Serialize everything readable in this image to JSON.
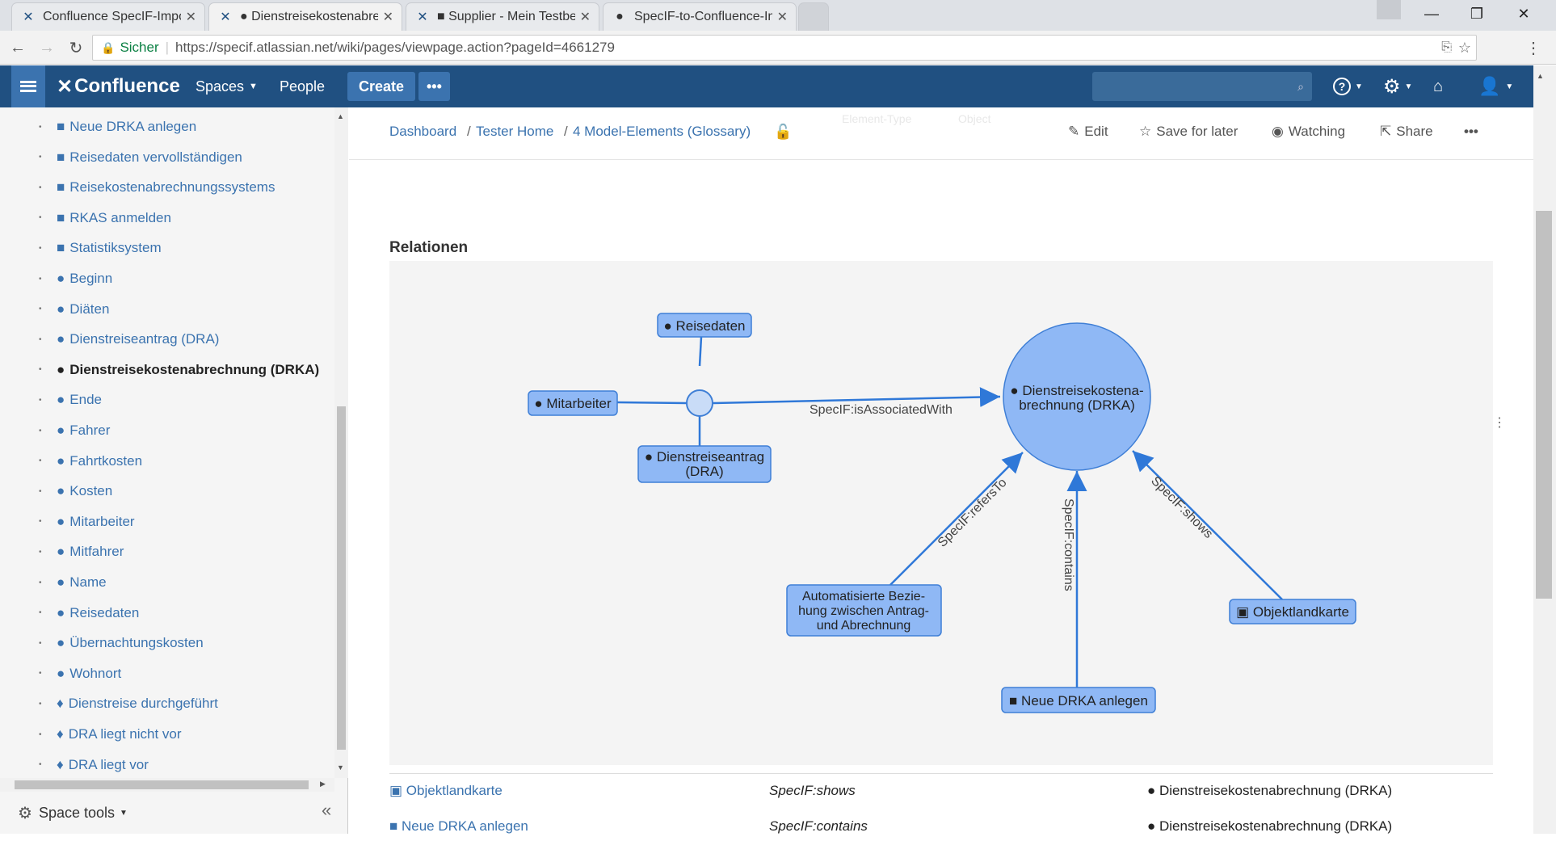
{
  "browser": {
    "tabs": [
      {
        "title": "Confluence SpecIF-Impo",
        "icon": "confluence-icon"
      },
      {
        "title": "● Dienstreisekostenabrec",
        "icon": "confluence-icon"
      },
      {
        "title": "■ Supplier - Mein Testbe",
        "icon": "confluence-icon"
      },
      {
        "title": "SpecIF-to-Confluence-Im",
        "icon": "github-icon"
      }
    ],
    "secure_label": "Sicher",
    "url": "https://specif.atlassian.net/wiki/pages/viewpage.action?pageId=4661279"
  },
  "header": {
    "logo": "Confluence",
    "spaces": "Spaces",
    "people": "People",
    "create": "Create",
    "more": "•••",
    "search_placeholder": ""
  },
  "sidebar": {
    "items": [
      {
        "bullet": "■",
        "label": "Neue DRKA anlegen"
      },
      {
        "bullet": "■",
        "label": "Reisedaten vervollständigen"
      },
      {
        "bullet": "■",
        "label": "Reisekostenabrechnungssystems"
      },
      {
        "bullet": "■",
        "label": "RKAS anmelden"
      },
      {
        "bullet": "■",
        "label": "Statistiksystem"
      },
      {
        "bullet": "●",
        "label": "Beginn"
      },
      {
        "bullet": "●",
        "label": "Diäten"
      },
      {
        "bullet": "●",
        "label": "Dienstreiseantrag (DRA)"
      },
      {
        "bullet": "●",
        "label": "Dienstreisekostenabrechnung (DRKA)",
        "active": true
      },
      {
        "bullet": "●",
        "label": "Ende"
      },
      {
        "bullet": "●",
        "label": "Fahrer"
      },
      {
        "bullet": "●",
        "label": "Fahrtkosten"
      },
      {
        "bullet": "●",
        "label": "Kosten"
      },
      {
        "bullet": "●",
        "label": "Mitarbeiter"
      },
      {
        "bullet": "●",
        "label": "Mitfahrer"
      },
      {
        "bullet": "●",
        "label": "Name"
      },
      {
        "bullet": "●",
        "label": "Reisedaten"
      },
      {
        "bullet": "●",
        "label": "Übernachtungskosten"
      },
      {
        "bullet": "●",
        "label": "Wohnort"
      },
      {
        "bullet": "♦",
        "label": "Dienstreise durchgeführt"
      },
      {
        "bullet": "♦",
        "label": "DRA liegt nicht vor"
      },
      {
        "bullet": "♦",
        "label": "DRA liegt vor"
      }
    ],
    "space_tools": "Space tools",
    "collapse": "«"
  },
  "breadcrumb": [
    {
      "label": "Dashboard"
    },
    {
      "label": "Tester Home"
    },
    {
      "label": "4 Model-Elements (Glossary)"
    }
  ],
  "actions": {
    "edit": "Edit",
    "save_for_later": "Save for later",
    "watching": "Watching",
    "share": "Share",
    "more": "•••"
  },
  "faded_labels": {
    "a": "Element-Type",
    "b": "Object"
  },
  "section_title": "Relationen",
  "diagram": {
    "nodes": {
      "reisedaten": "● Reisedaten",
      "mitarbeiter": "● Mitarbeiter",
      "dra": [
        "● Dienstreiseantrag",
        "(DRA)"
      ],
      "drka": [
        "● Dienstreisekostena-",
        "brechnung (DRKA)"
      ],
      "auto": [
        "Automatisierte Bezie-",
        "hung zwischen Antrag-",
        "und Abrechnung"
      ],
      "objektlandkarte": "▣ Objektlandkarte",
      "neue": "■ Neue DRKA anlegen"
    },
    "edges": {
      "assoc": "SpecIF:isAssociatedWith",
      "refers": "SpecIF:refersTo",
      "contains": "SpecIF:contains",
      "shows": "SpecIF:shows"
    }
  },
  "table": {
    "rows": [
      {
        "subject": "▣ Objektlandkarte",
        "predicate": "SpecIF:shows",
        "object": "● Dienstreisekostenabrechnung (DRKA)"
      },
      {
        "subject": "■ Neue DRKA anlegen",
        "predicate": "SpecIF:contains",
        "object": "● Dienstreisekostenabrechnung (DRKA)"
      }
    ]
  },
  "colors": {
    "header": "#205081",
    "link": "#3b73af",
    "node_fill": "#8fb8f5",
    "node_stroke": "#3f7fd6",
    "edge": "#2f78d8"
  }
}
